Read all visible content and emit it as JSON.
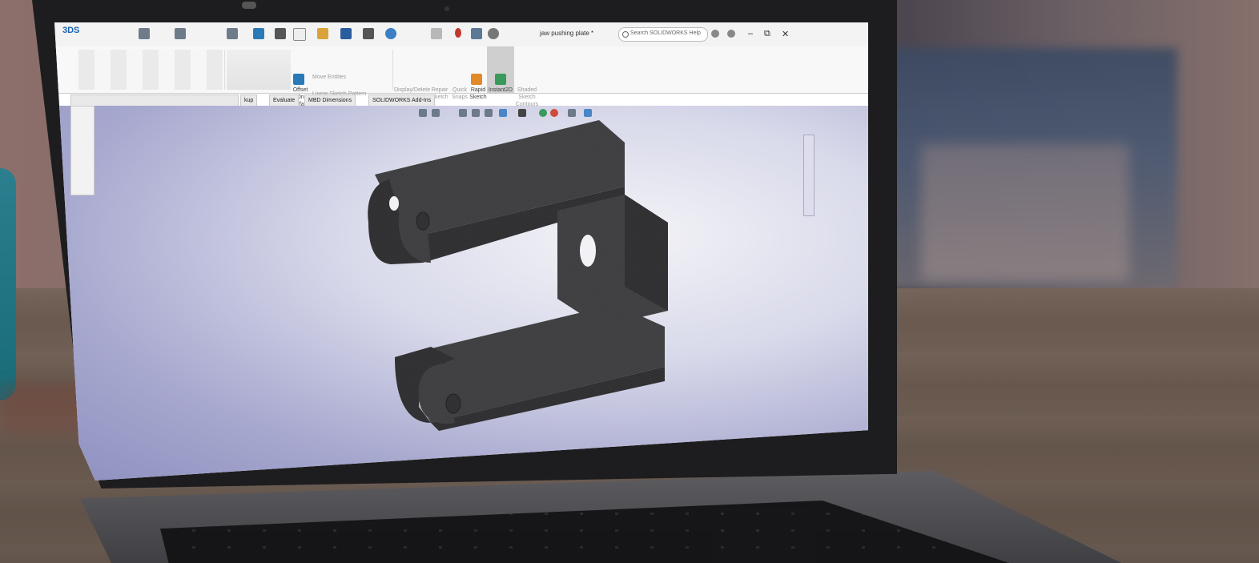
{
  "window": {
    "title": "jaw pushing plate *",
    "search_placeholder": "Search SOLIDWORKS Help",
    "minimize": "–",
    "restore": "⧉",
    "close": "✕"
  },
  "ribbon": {
    "offset_on_surface": "Offset\nOn\nSurface",
    "move_entities": "Move Entities",
    "linear_sketch_pattern": "Linear Sketch Pattern",
    "display_delete_relations": "Display/Delete\nRelations",
    "repair_sketch": "Repair\nSketch",
    "quick_snaps": "Quick\nSnaps",
    "rapid_sketch": "Rapid\nSketch",
    "instant2d": "Instant2D",
    "shaded_sketch_contours": "Shaded\nSketch\nContours"
  },
  "tabs": [
    {
      "label": "kup"
    },
    {
      "label": "Evaluate"
    },
    {
      "label": "MBD Dimensions"
    },
    {
      "label": "SOLIDWORKS Add-Ins"
    }
  ],
  "colors": {
    "part": "#3a3a3c",
    "viewport_edge": "#8d8fbf",
    "brand": "#1a63b5"
  },
  "icons": [
    "solidworks-logo",
    "new-document-icon",
    "open-folder-icon",
    "save-icon",
    "print-icon",
    "undo-icon",
    "select-arrow-icon",
    "traffic-light-icon",
    "options-gear-icon",
    "search-icon",
    "help-icon"
  ]
}
